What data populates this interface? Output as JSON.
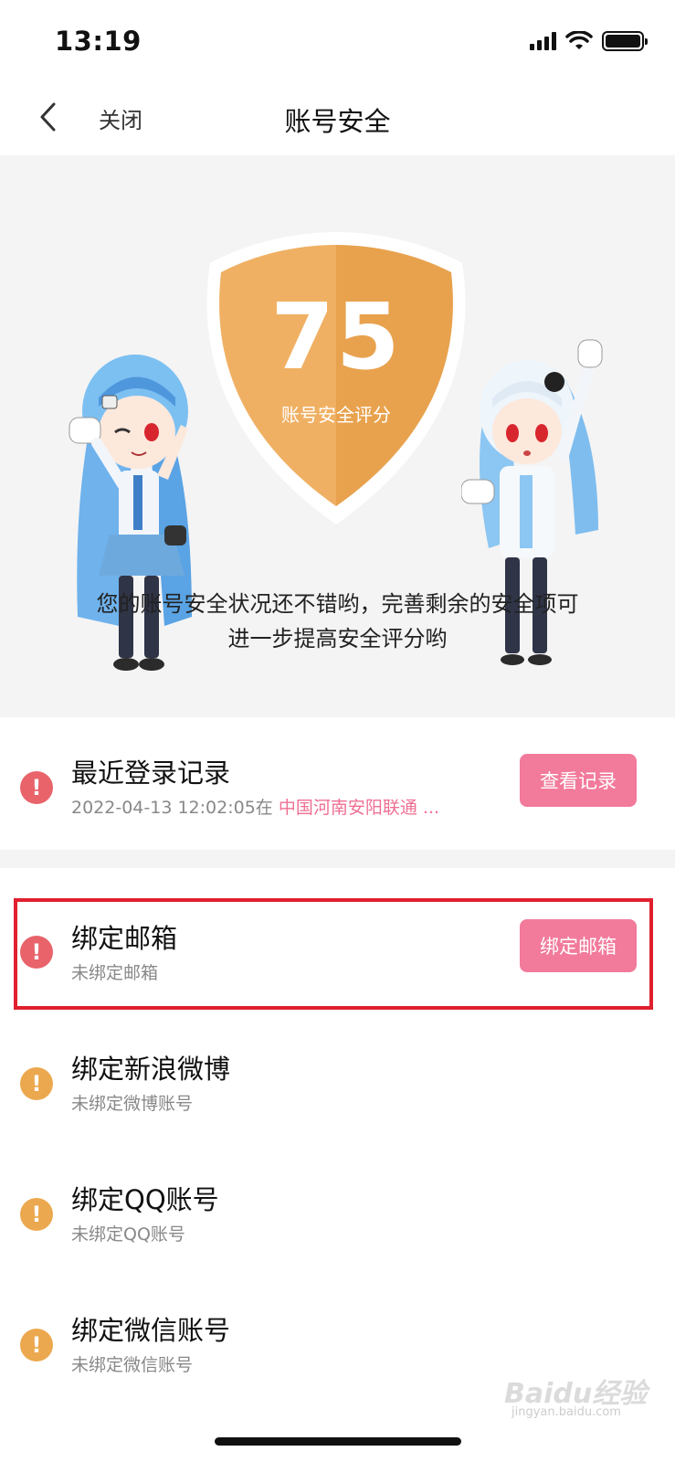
{
  "status_bar": {
    "time": "13:19"
  },
  "nav": {
    "close_label": "关闭",
    "title": "账号安全"
  },
  "hero": {
    "score": "75",
    "score_label": "账号安全评分",
    "description_line1": "您的账号安全状况还不错哟，完善剩余的安全项可",
    "description_line2": "进一步提高安全评分哟"
  },
  "rows": [
    {
      "title": "最近登录记录",
      "subtitle_time": "2022-04-13 12:02:05在 ",
      "subtitle_location": "中国河南安阳联通 ...",
      "button": "查看记录",
      "status": "red"
    },
    {
      "title": "绑定邮箱",
      "subtitle": "未绑定邮箱",
      "button": "绑定邮箱",
      "status": "red"
    },
    {
      "title": "绑定新浪微博",
      "subtitle": "未绑定微博账号",
      "status": "orange"
    },
    {
      "title": "绑定QQ账号",
      "subtitle": "未绑定QQ账号",
      "status": "orange"
    },
    {
      "title": "绑定微信账号",
      "subtitle": "未绑定微信账号",
      "status": "orange"
    }
  ],
  "watermark": {
    "brand": "Baidu经验",
    "sub": "jingyan.baidu.com"
  },
  "colors": {
    "pink": "#f27a9b",
    "alert_red": "#e8636a",
    "alert_orange": "#eca84e",
    "shield": "#eba957",
    "highlight": "#e0202e"
  }
}
